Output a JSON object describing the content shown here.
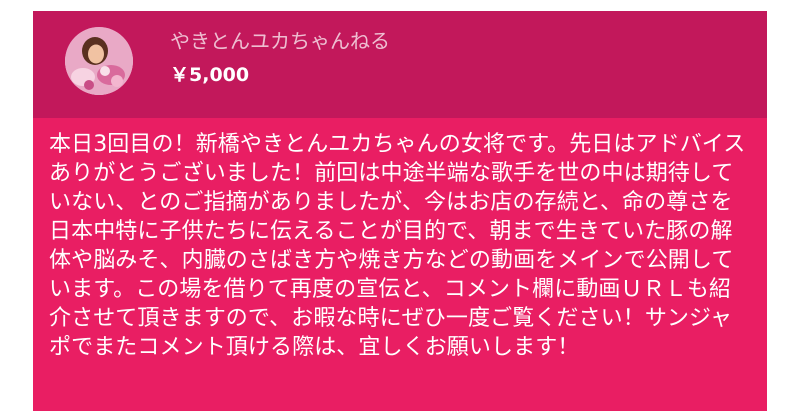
{
  "header": {
    "author_name": "やきとんユカちゃんねる",
    "amount": "￥5,000",
    "avatar_icon": "user-avatar-photo"
  },
  "colors": {
    "header_bg": "#c2185b",
    "body_bg": "#e91e63",
    "text": "#ffffff"
  },
  "message": {
    "text": "本日3回目の！新橋やきとんユカちゃんの女将です。先日はアドバイスありがとうございました！前回は中途半端な歌手を世の中は期待していない、とのご指摘がありましたが、今はお店の存続と、命の尊さを日本中特に子供たちに伝えることが目的で、朝まで生きていた豚の解体や脳みそ、内臓のさばき方や焼き方などの動画をメインで公開しています。この場を借りて再度の宣伝と、コメント欄に動画ＵＲＬも紹介させて頂きますので、お暇な時にぜひ一度ご覧ください！サンジャポでまたコメント頂ける際は、宜しくお願いします！"
  }
}
